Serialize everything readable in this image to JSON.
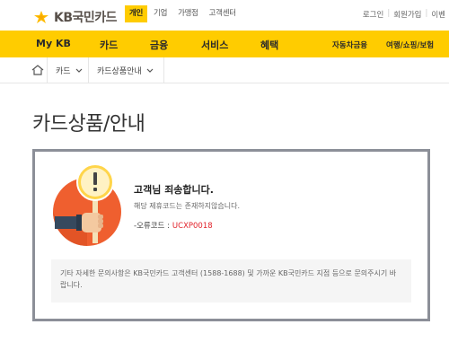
{
  "header": {
    "logo_text": "KB국민카드",
    "segments": [
      {
        "label": "개인",
        "active": true
      },
      {
        "label": "기업",
        "active": false
      },
      {
        "label": "가맹점",
        "active": false
      },
      {
        "label": "고객센터",
        "active": false
      }
    ],
    "util_links": [
      "로그인",
      "회원가입",
      "이벤"
    ]
  },
  "nav": {
    "items": [
      "My KB",
      "카드",
      "금융",
      "서비스",
      "혜택"
    ],
    "sub_items": [
      "자동차금융",
      "여행/쇼핑/보험"
    ],
    "bg_color": "#ffcc00"
  },
  "breadcrumb": {
    "home_icon": "home-icon",
    "items": [
      "카드",
      "카드상품안내"
    ]
  },
  "page": {
    "title": "카드상품/안내"
  },
  "error": {
    "title": "고객님 죄송합니다.",
    "description": "해당 제휴코드는 존재하지않습니다.",
    "code_label": "-오류코드 :",
    "code_value": "UCXP0018",
    "code_color": "#e2222a",
    "notice": "기타 자세한 문의사항은 KB국민카드 고객센터 (1588-1688) 및 가까운 KB국민카드 지점 등으로 문의주시기 바랍니다.",
    "illustration_icon": "warning-sign-hand-icon"
  }
}
